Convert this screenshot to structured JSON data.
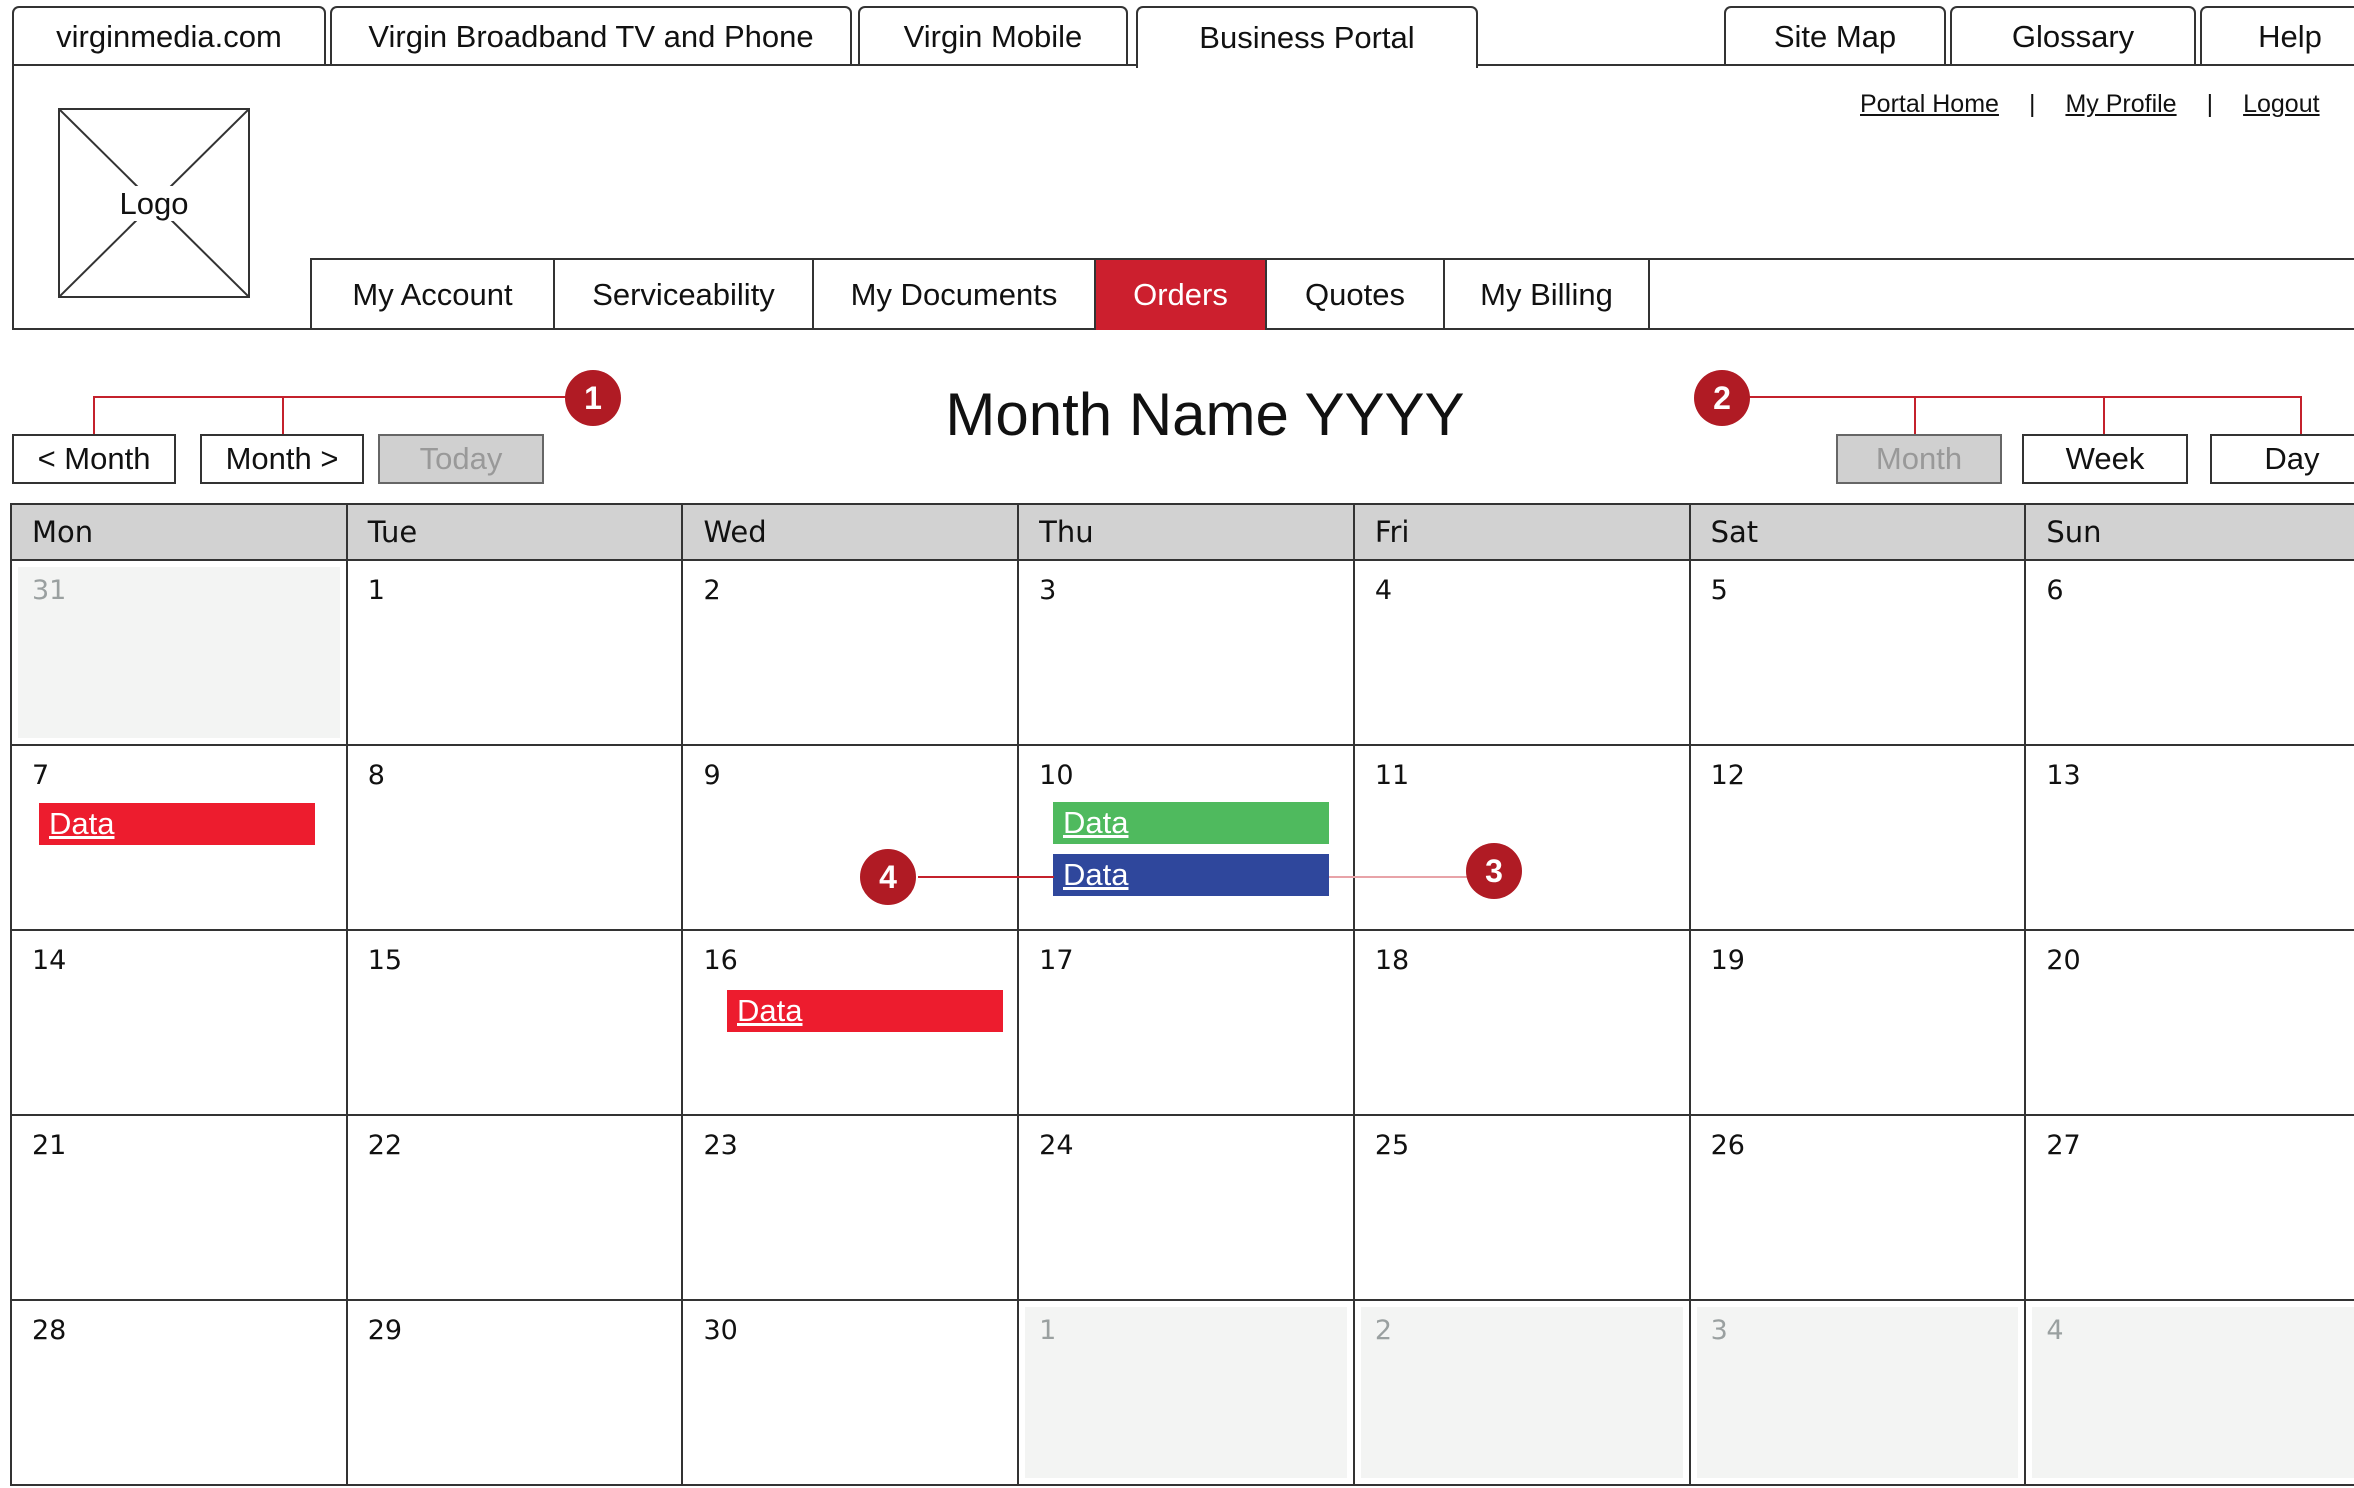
{
  "site_tabs": [
    {
      "label": "virginmedia.com"
    },
    {
      "label": "Virgin Broadband TV and Phone"
    },
    {
      "label": "Virgin Mobile"
    },
    {
      "label": "Business Portal"
    },
    {
      "label": "Site Map"
    },
    {
      "label": "Glossary"
    },
    {
      "label": "Help"
    }
  ],
  "logo": {
    "label": "Logo"
  },
  "util_links": {
    "portal_home": "Portal Home",
    "my_profile": "My Profile",
    "logout": "Logout",
    "separator": "|"
  },
  "main_nav": [
    {
      "label": "My Account"
    },
    {
      "label": "Serviceability"
    },
    {
      "label": "My Documents"
    },
    {
      "label": "Orders"
    },
    {
      "label": "Quotes"
    },
    {
      "label": "My Billing"
    }
  ],
  "controls": {
    "prev": "< Month",
    "next": "Month >",
    "today": "Today",
    "title": "Month Name YYYY",
    "view_month": "Month",
    "view_week": "Week",
    "view_day": "Day"
  },
  "callouts": [
    "1",
    "2",
    "3",
    "4"
  ],
  "calendar": {
    "day_headers": [
      "Mon",
      "Tue",
      "Wed",
      "Thu",
      "Fri",
      "Sat",
      "Sun"
    ],
    "weeks": [
      [
        {
          "d": "31",
          "out": true
        },
        {
          "d": "1"
        },
        {
          "d": "2"
        },
        {
          "d": "3"
        },
        {
          "d": "4"
        },
        {
          "d": "5"
        },
        {
          "d": "6"
        }
      ],
      [
        {
          "d": "7"
        },
        {
          "d": "8"
        },
        {
          "d": "9"
        },
        {
          "d": "10"
        },
        {
          "d": "11"
        },
        {
          "d": "12"
        },
        {
          "d": "13"
        }
      ],
      [
        {
          "d": "14"
        },
        {
          "d": "15"
        },
        {
          "d": "16"
        },
        {
          "d": "17"
        },
        {
          "d": "18"
        },
        {
          "d": "19"
        },
        {
          "d": "20"
        }
      ],
      [
        {
          "d": "21"
        },
        {
          "d": "22"
        },
        {
          "d": "23"
        },
        {
          "d": "24"
        },
        {
          "d": "25"
        },
        {
          "d": "26"
        },
        {
          "d": "27"
        }
      ],
      [
        {
          "d": "28"
        },
        {
          "d": "29"
        },
        {
          "d": "30"
        },
        {
          "d": "1",
          "out": true
        },
        {
          "d": "2",
          "out": true
        },
        {
          "d": "3",
          "out": true
        },
        {
          "d": "4",
          "out": true
        }
      ]
    ],
    "events": [
      {
        "label": "Data",
        "color": "#ed1c2e"
      },
      {
        "label": "Data",
        "color": "#4fba5e"
      },
      {
        "label": "Data",
        "color": "#2f479c"
      },
      {
        "label": "Data",
        "color": "#ed1c2e"
      }
    ]
  }
}
